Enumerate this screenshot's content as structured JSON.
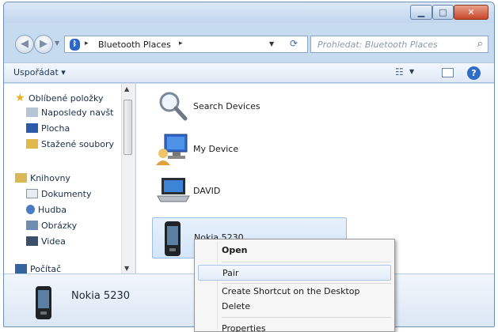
{
  "address": {
    "location": "Bluetooth Places",
    "search_placeholder": "Prohledat: Bluetooth Places"
  },
  "toolbar": {
    "organize_label": "Uspořádat ▾"
  },
  "sidebar": {
    "favorites": "Oblíbené položky",
    "items": [
      {
        "label": "Naposledy navšt"
      },
      {
        "label": "Plocha"
      },
      {
        "label": "Stažené soubory"
      }
    ],
    "libraries": "Knihovny",
    "library_items": [
      {
        "label": "Dokumenty"
      },
      {
        "label": "Hudba"
      },
      {
        "label": "Obrázky"
      },
      {
        "label": "Videa"
      }
    ],
    "computer": "Počítač"
  },
  "devices": [
    {
      "label": "Search Devices",
      "icon": "magnifier-icon"
    },
    {
      "label": "My Device",
      "icon": "computer-user-icon"
    },
    {
      "label": "DAVID",
      "icon": "laptop-icon"
    },
    {
      "label": "Nokia 5230",
      "icon": "phone-icon",
      "selected": true
    }
  ],
  "context_menu": {
    "items": [
      {
        "label": "Open",
        "bold": true
      },
      {
        "label": "Pair",
        "hover": true
      },
      {
        "label": "Create Shortcut on the Desktop"
      },
      {
        "label": "Delete"
      },
      {
        "label": "Properties"
      }
    ]
  },
  "details": {
    "name": "Nokia 5230"
  },
  "colors": {
    "selection": "#d3e5f8",
    "menu_highlight": "#e3edf9",
    "close_button": "#c7462a"
  }
}
